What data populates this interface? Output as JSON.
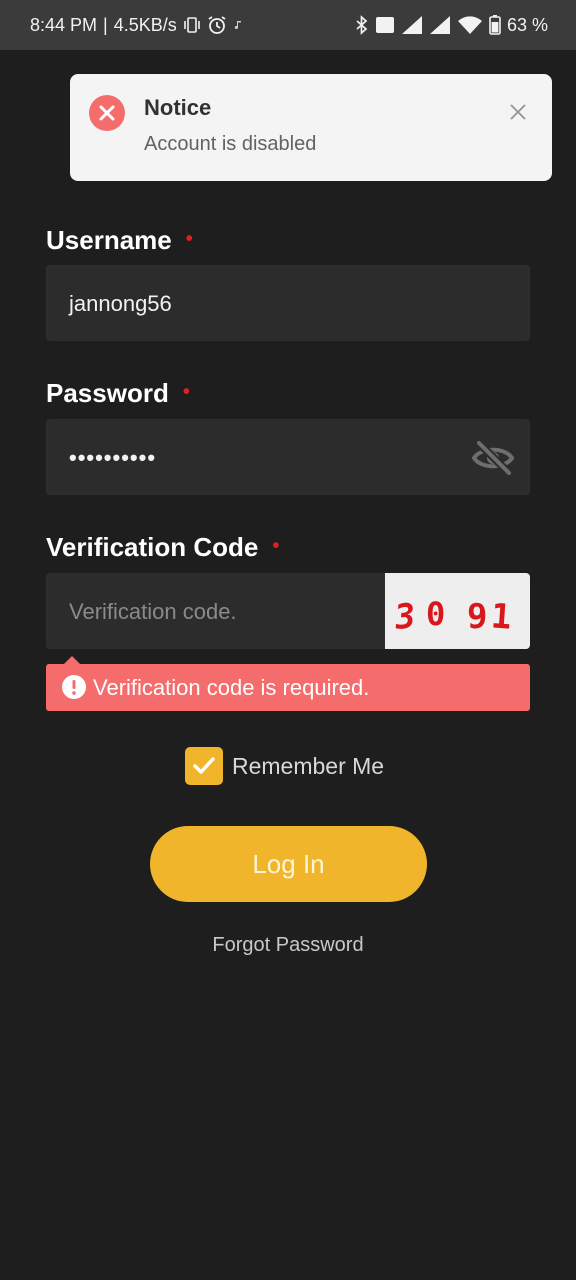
{
  "status_bar": {
    "time": "8:44 PM",
    "separator": "|",
    "net_speed": "4.5KB/s",
    "volte_label": "Vo LTE",
    "battery_percent": "63 %",
    "icons": [
      "vibrate-icon",
      "alarm-icon",
      "music-note-icon",
      "bluetooth-icon",
      "volte-icon",
      "signal-icon",
      "signal-icon",
      "wifi-icon",
      "battery-icon"
    ]
  },
  "notice": {
    "title": "Notice",
    "message": "Account is disabled",
    "icon": "error-circle-icon",
    "close_icon": "close-icon",
    "icon_color": "#f56c6c"
  },
  "form": {
    "username": {
      "label": "Username",
      "required_mark": "•",
      "value": "jannong56"
    },
    "password": {
      "label": "Password",
      "required_mark": "•",
      "value_masked": "••••••••••",
      "toggle_icon": "eye-off-icon"
    },
    "verification": {
      "label": "Verification Code",
      "required_mark": "•",
      "placeholder": "Verification code.",
      "value": "",
      "captcha_digits": [
        "3",
        "0",
        "9",
        "1"
      ],
      "error": "Verification code is required."
    },
    "remember_me": {
      "label": "Remember Me",
      "checked": true
    },
    "login_label": "Log In",
    "forgot_label": "Forgot Password"
  },
  "colors": {
    "background": "#1e1e1e",
    "input_bg": "#2c2c2c",
    "accent": "#f0b52b",
    "error": "#f56c6c",
    "required": "#e02020",
    "captcha_text": "#d8161b"
  }
}
